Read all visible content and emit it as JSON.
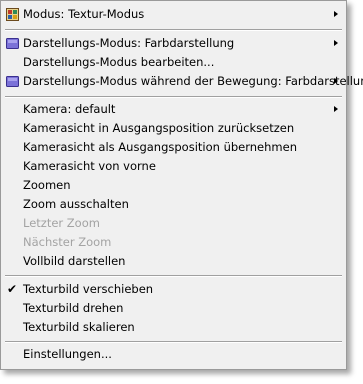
{
  "menu": {
    "modus": {
      "label": "Modus:  Textur-Modus",
      "has_submenu": true,
      "icon": "texture-mode-icon"
    },
    "darstellungs_modus": {
      "label": "Darstellungs-Modus: Farbdarstellung",
      "has_submenu": true,
      "icon": "cube-icon"
    },
    "darstellungs_modus_bearbeiten": {
      "label": "Darstellungs-Modus bearbeiten..."
    },
    "darstellungs_modus_bewegung": {
      "label": "Darstellungs-Modus während der Bewegung: Farbdarstellung",
      "has_submenu": true,
      "icon": "cube-icon"
    },
    "kamera": {
      "label": "Kamera: default",
      "has_submenu": true
    },
    "kamerasicht_zuruecksetzen": {
      "label": "Kamerasicht in Ausgangsposition zurücksetzen"
    },
    "kamerasicht_uebernehmen": {
      "label": "Kamerasicht als Ausgangsposition übernehmen"
    },
    "kamerasicht_vorne": {
      "label": "Kamerasicht von vorne"
    },
    "zoomen": {
      "label": "Zoomen"
    },
    "zoom_ausschalten": {
      "label": "Zoom ausschalten"
    },
    "letzter_zoom": {
      "label": "Letzter Zoom",
      "disabled": true
    },
    "naechster_zoom": {
      "label": "Nächster Zoom",
      "disabled": true
    },
    "vollbild": {
      "label": "Vollbild darstellen"
    },
    "texturbild_verschieben": {
      "label": "Texturbild verschieben",
      "checked": true,
      "check_glyph": "✔"
    },
    "texturbild_drehen": {
      "label": "Texturbild drehen"
    },
    "texturbild_skalieren": {
      "label": "Texturbild skalieren"
    },
    "einstellungen": {
      "label": "Einstellungen..."
    }
  },
  "colors": {
    "menu_background": "#f0f0f0",
    "disabled_text": "#a3a3a3",
    "cube_icon": "#6a5acd"
  }
}
